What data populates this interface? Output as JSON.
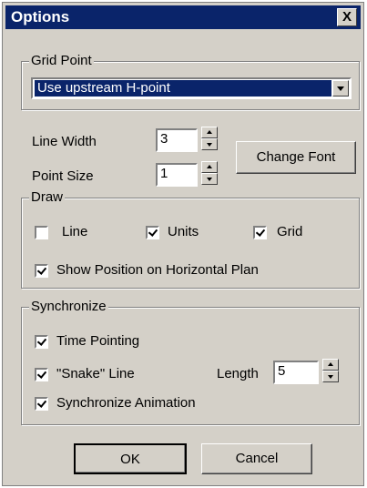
{
  "window": {
    "title": "Options",
    "close_symbol": "X"
  },
  "grid_point": {
    "legend": "Grid Point",
    "selected": "Use upstream H-point"
  },
  "line_width": {
    "label": "Line Width",
    "value": "3"
  },
  "point_size": {
    "label": "Point Size",
    "value": "1"
  },
  "change_font_label": "Change Font",
  "draw": {
    "legend": "Draw",
    "line": {
      "label": "Line",
      "checked": false
    },
    "units": {
      "label": "Units",
      "checked": true
    },
    "grid": {
      "label": "Grid",
      "checked": true
    },
    "show_position": {
      "label": "Show Position on Horizontal Plan",
      "checked": true
    }
  },
  "synchronize": {
    "legend": "Synchronize",
    "time_pointing": {
      "label": "Time Pointing",
      "checked": true
    },
    "snake_line": {
      "label": "\"Snake\" Line",
      "checked": true
    },
    "length": {
      "label": "Length",
      "value": "5"
    },
    "sync_animation": {
      "label": "Synchronize Animation",
      "checked": true
    }
  },
  "buttons": {
    "ok": "OK",
    "cancel": "Cancel"
  }
}
